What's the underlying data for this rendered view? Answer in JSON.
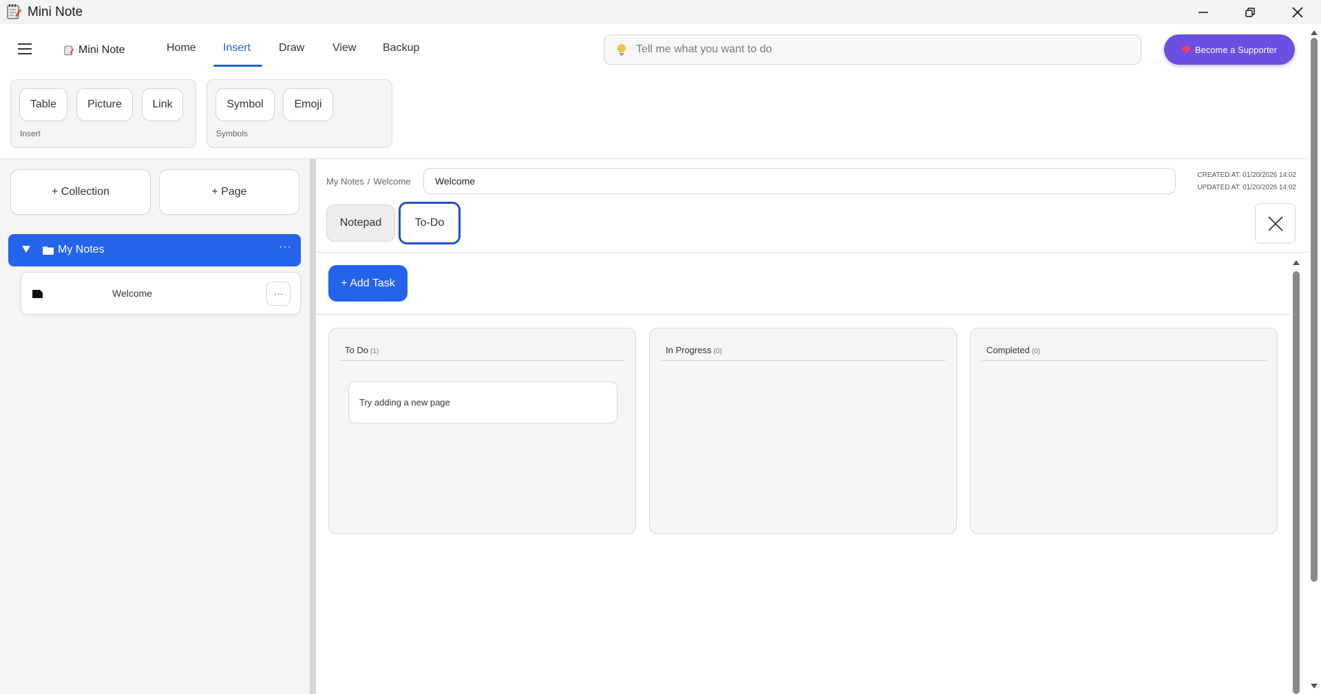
{
  "window": {
    "title": "Mini Note"
  },
  "ribbon": {
    "brand": "Mini Note",
    "tabs": [
      {
        "label": "Home"
      },
      {
        "label": "Insert"
      },
      {
        "label": "Draw"
      },
      {
        "label": "View"
      },
      {
        "label": "Backup"
      }
    ],
    "active_tab": "Insert",
    "search_placeholder": "Tell me what you want to do",
    "supporter_label": "Become a Supporter",
    "groups": {
      "insert": {
        "label": "Insert",
        "buttons": [
          "Table",
          "Picture",
          "Link"
        ]
      },
      "symbols": {
        "label": "Symbols",
        "buttons": [
          "Symbol",
          "Emoji"
        ]
      }
    }
  },
  "sidebar": {
    "add_collection": "+ Collection",
    "add_page": "+ Page",
    "collection": {
      "name": "My Notes",
      "more": "···"
    },
    "pages": [
      {
        "name": "Welcome",
        "more": "···"
      }
    ]
  },
  "note": {
    "breadcrumb": [
      "My Notes",
      "Welcome"
    ],
    "breadcrumb_sep": "/",
    "title": "Welcome",
    "created": "CREATED AT: 01/20/2026 14:02",
    "updated": "UPDATED AT: 01/20/2026 14:02",
    "modes": [
      "Notepad",
      "To-Do"
    ],
    "active_mode": "To-Do"
  },
  "todo": {
    "add_task": "+ Add Task",
    "columns": [
      {
        "title": "To Do",
        "count": "(1)",
        "tasks": [
          "Try adding a new page"
        ]
      },
      {
        "title": "In Progress",
        "count": "(0)",
        "tasks": []
      },
      {
        "title": "Completed",
        "count": "(0)",
        "tasks": []
      }
    ]
  },
  "colors": {
    "accent": "#2563eb",
    "supporter": "#6a4fe0",
    "active_outline": "#1e4fc7"
  }
}
